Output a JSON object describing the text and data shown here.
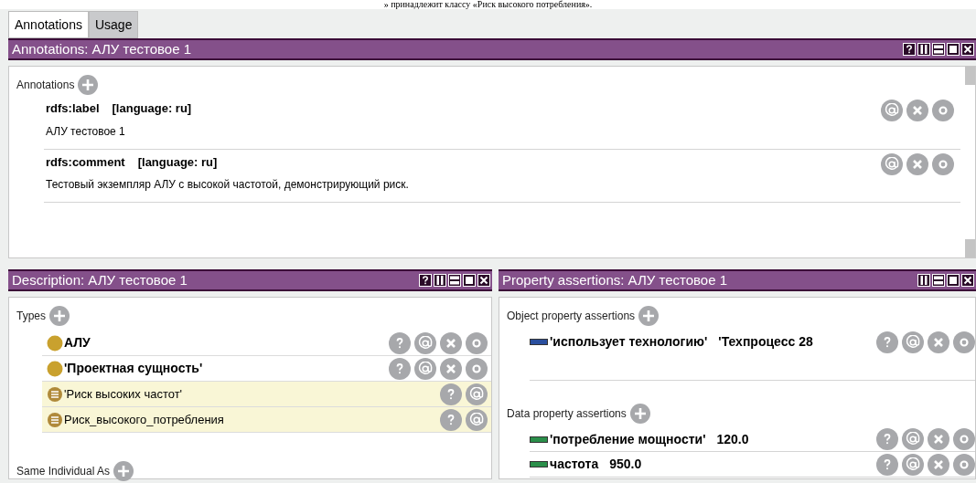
{
  "caption": "» принадлежит классу «Риск высокого потребления».",
  "tabs": [
    {
      "label": "Annotations",
      "selected": true
    },
    {
      "label": "Usage",
      "selected": false
    }
  ],
  "annotations_view": {
    "title": "Annotations: АЛУ тестовое 1",
    "help": true,
    "section": "Annotations",
    "items": [
      {
        "property": "rdfs:label",
        "lang": "[language: ru]",
        "value": "АЛУ тестовое 1"
      },
      {
        "property": "rdfs:comment",
        "lang": "[language: ru]",
        "value": "Тестовый экземпляр АЛУ с высокой частотой, демонстрирующий риск."
      }
    ]
  },
  "description_view": {
    "title": "Description: АЛУ тестовое 1",
    "help": true,
    "types_section": "Types",
    "types": [
      {
        "label": "АЛУ",
        "inferred": false
      },
      {
        "label": "'Проектная сущность'",
        "inferred": false
      },
      {
        "label": "'Риск высоких частот'",
        "inferred": true
      },
      {
        "label": "Риск_высокого_потребления",
        "inferred": true
      }
    ],
    "same_section": "Same Individual As"
  },
  "property_view": {
    "title": "Property assertions: АЛУ тестовое 1",
    "help": false,
    "sections": [
      {
        "label": "Object property assertions",
        "rows": [
          {
            "kind": "object",
            "property": "'использует технологию'",
            "value": "'Техпроцесс 28"
          }
        ]
      },
      {
        "label": "Data property assertions",
        "rows": [
          {
            "kind": "data",
            "property": "'потребление мощности'",
            "value": "120.0"
          },
          {
            "kind": "data",
            "property": "частота",
            "value": "950.0"
          }
        ]
      }
    ]
  }
}
